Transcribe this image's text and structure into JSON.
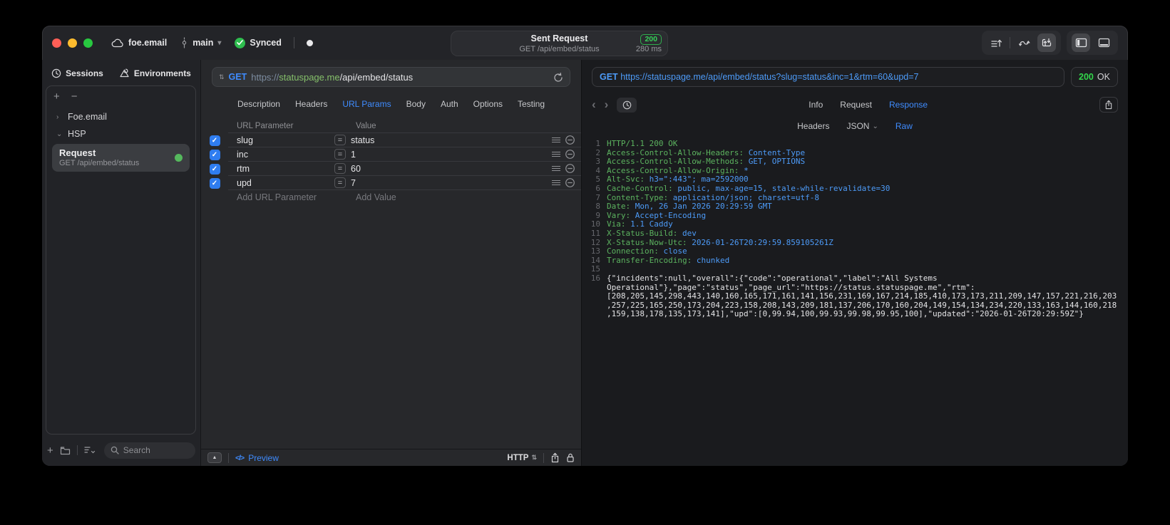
{
  "titlebar": {
    "project_name": "foe.email",
    "branch_name": "main",
    "sync_label": "Synced",
    "request_summary": {
      "title": "Sent Request",
      "status_code": "200",
      "request_line": "GET /api/embed/status",
      "duration": "280 ms"
    }
  },
  "sidebar": {
    "tabs": [
      {
        "label": "Sessions"
      },
      {
        "label": "Environments"
      }
    ],
    "groups": [
      {
        "label": "Foe.email"
      },
      {
        "label": "HSP"
      }
    ],
    "request_item": {
      "title": "Request",
      "subtitle": "GET /api/embed/status"
    },
    "search_placeholder": "Search"
  },
  "request_editor": {
    "method": "GET",
    "url": {
      "scheme": "https://",
      "host": "statuspage.me",
      "path": "/api/embed/status"
    },
    "tabs": [
      "Description",
      "Headers",
      "URL Params",
      "Body",
      "Auth",
      "Options",
      "Testing"
    ],
    "active_tab": "URL Params",
    "params": {
      "columns": [
        "URL Parameter",
        "Value"
      ],
      "rows": [
        {
          "name": "slug",
          "value": "status",
          "enabled": true
        },
        {
          "name": "inc",
          "value": "1",
          "enabled": true
        },
        {
          "name": "rtm",
          "value": "60",
          "enabled": true
        },
        {
          "name": "upd",
          "value": "7",
          "enabled": true
        }
      ],
      "add_name_placeholder": "Add URL Parameter",
      "add_value_placeholder": "Add Value"
    },
    "footer": {
      "preview_label": "Preview",
      "protocol": "HTTP"
    }
  },
  "response_viewer": {
    "method": "GET",
    "url": "https://statuspage.me/api/embed/status?slug=status&inc=1&rtm=60&upd=7",
    "status_code": "200",
    "status_text": "OK",
    "tabs": [
      "Info",
      "Request",
      "Response"
    ],
    "active_tab": "Response",
    "subtabs": [
      "Headers",
      "JSON",
      "Raw"
    ],
    "active_subtab": "Raw",
    "body_lines": [
      {
        "n": "1",
        "segments": [
          {
            "text": "HTTP/1.1 200 OK",
            "color": "green"
          }
        ]
      },
      {
        "n": "2",
        "segments": [
          {
            "text": "Access-Control-Allow-Headers: ",
            "color": "green"
          },
          {
            "text": "Content-Type",
            "color": "blue"
          }
        ]
      },
      {
        "n": "3",
        "segments": [
          {
            "text": "Access-Control-Allow-Methods: ",
            "color": "green"
          },
          {
            "text": "GET, OPTIONS",
            "color": "blue"
          }
        ]
      },
      {
        "n": "4",
        "segments": [
          {
            "text": "Access-Control-Allow-Origin: ",
            "color": "green"
          },
          {
            "text": "*",
            "color": "blue"
          }
        ]
      },
      {
        "n": "5",
        "segments": [
          {
            "text": "Alt-Svc: ",
            "color": "green"
          },
          {
            "text": "h3=\":443\"; ma=2592000",
            "color": "blue"
          }
        ]
      },
      {
        "n": "6",
        "segments": [
          {
            "text": "Cache-Control: ",
            "color": "green"
          },
          {
            "text": "public, max-age=15, stale-while-revalidate=30",
            "color": "blue"
          }
        ]
      },
      {
        "n": "7",
        "segments": [
          {
            "text": "Content-Type: ",
            "color": "green"
          },
          {
            "text": "application/json; charset=utf-8",
            "color": "blue"
          }
        ]
      },
      {
        "n": "8",
        "segments": [
          {
            "text": "Date: ",
            "color": "green"
          },
          {
            "text": "Mon, 26 Jan 2026 20:29:59 GMT",
            "color": "blue"
          }
        ]
      },
      {
        "n": "9",
        "segments": [
          {
            "text": "Vary: ",
            "color": "green"
          },
          {
            "text": "Accept-Encoding",
            "color": "blue"
          }
        ]
      },
      {
        "n": "10",
        "segments": [
          {
            "text": "Via: ",
            "color": "green"
          },
          {
            "text": "1.1 Caddy",
            "color": "blue"
          }
        ]
      },
      {
        "n": "11",
        "segments": [
          {
            "text": "X-Status-Build: ",
            "color": "green"
          },
          {
            "text": "dev",
            "color": "blue"
          }
        ]
      },
      {
        "n": "12",
        "segments": [
          {
            "text": "X-Status-Now-Utc: ",
            "color": "green"
          },
          {
            "text": "2026-01-26T20:29:59.859105261Z",
            "color": "blue"
          }
        ]
      },
      {
        "n": "13",
        "segments": [
          {
            "text": "Connection: ",
            "color": "green"
          },
          {
            "text": "close",
            "color": "blue"
          }
        ]
      },
      {
        "n": "14",
        "segments": [
          {
            "text": "Transfer-Encoding: ",
            "color": "green"
          },
          {
            "text": "chunked",
            "color": "blue"
          }
        ]
      },
      {
        "n": "15",
        "segments": []
      },
      {
        "n": "16",
        "segments": [
          {
            "text": "{\"incidents\":null,\"overall\":{\"code\":\"operational\",\"label\":\"All Systems Operational\"},\"page\":\"status\",\"page_url\":\"https://status.statuspage.me\",\"rtm\":[208,205,145,298,443,140,160,165,171,161,141,156,231,169,167,214,185,410,173,173,211,209,147,157,221,216,203,257,225,165,250,173,204,223,158,208,143,209,181,137,206,170,160,204,149,154,134,234,220,133,163,144,160,218,159,138,178,135,173,141],\"upd\":[0,99.94,100,99.93,99.98,99.95,100],\"updated\":\"2026-01-26T20:29:59Z\"}",
            "color": "white"
          }
        ]
      }
    ]
  },
  "colors": {
    "accent_blue": "#3f8cff",
    "status_green": "#32d74b",
    "checkbox_blue": "#2f7df0",
    "traffic_red": "#ff5f57",
    "traffic_yellow": "#febc2e",
    "traffic_green": "#28c840"
  }
}
